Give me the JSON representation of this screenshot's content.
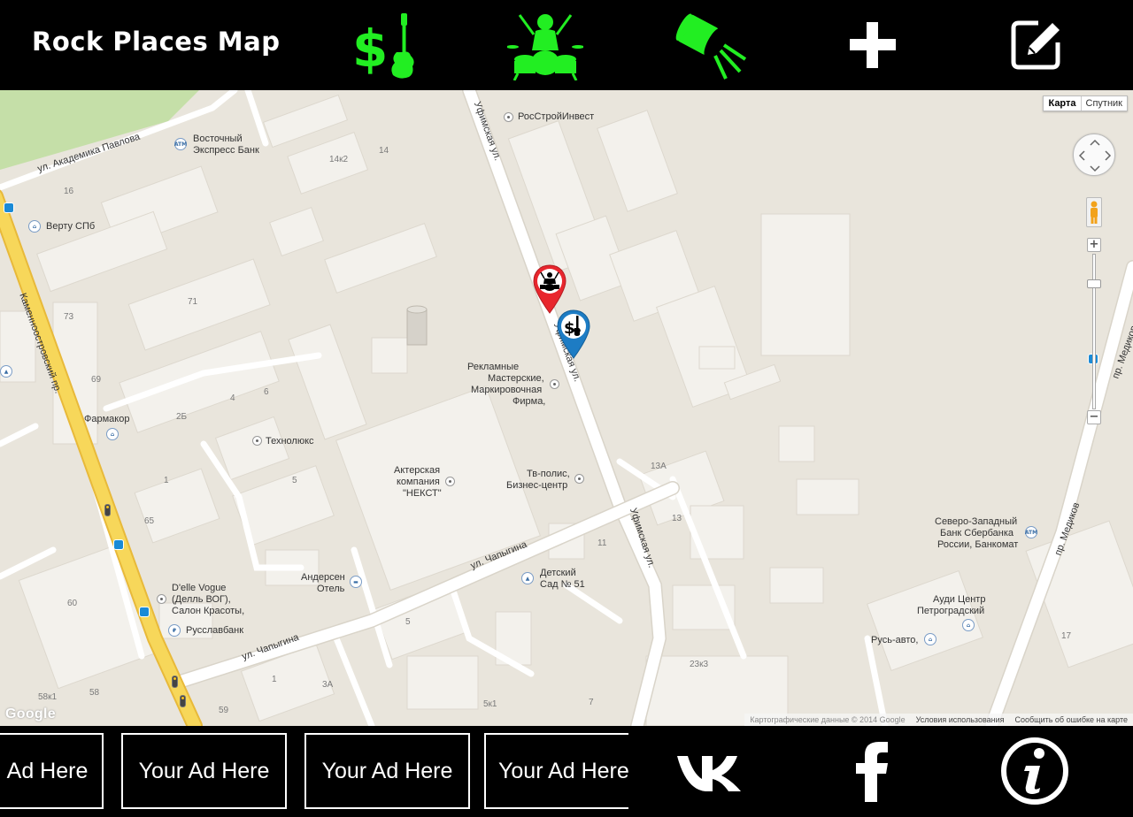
{
  "header": {
    "title": "Rock Places Map",
    "buttons": [
      {
        "name": "shop-icon",
        "icon": "dollar-guitar"
      },
      {
        "name": "drummer-icon",
        "icon": "drummer"
      },
      {
        "name": "spotlight-icon",
        "icon": "spotlight"
      },
      {
        "name": "add-icon",
        "icon": "plus"
      },
      {
        "name": "edit-icon",
        "icon": "edit-square"
      }
    ],
    "accent_color": "#22ee22"
  },
  "map": {
    "type_control": {
      "map": "Карта",
      "satellite": "Спутник",
      "selected": "Карта"
    },
    "zoom_in": "+",
    "zoom_out": "−",
    "provider_logo": "Google",
    "attribution": {
      "data": "Картографические данные © 2014 Google",
      "terms": "Условия использования",
      "report": "Сообщить об ошибке на карте"
    },
    "streets": {
      "akademika_pavlova": "ул. Академика Павлова",
      "ufimskaya_top": "Уфимская ул.",
      "ufimskaya_mid": "Уфимская ул.",
      "ufimskaya_low": "Уфимская ул.",
      "kamennoostrovsky": "Каменноостровский пр.",
      "chapygina_1": "ул. Чапыгина",
      "chapygina_2": "ул. Чапыгина",
      "medikov_1": "пр. Медиков",
      "medikov_2": "пр. Медиков"
    },
    "pois": {
      "rosstroyinvest": "РосСтройИнвест",
      "vostochny_line1": "Восточный",
      "vostochny_line2": "Экспресс Банк",
      "vertu": "Верту СПб",
      "reklamnye_1": "Рекламные",
      "reklamnye_2": "Мастерские,",
      "reklamnye_3": "Маркировочная",
      "reklamnye_4": "Фирма,",
      "farmakor": "Фармакор",
      "tekhnolyuks": "Технолюкс",
      "nekst_1": "Актерская",
      "nekst_2": "компания",
      "nekst_3": "\"НЕКСТ\"",
      "tvpolis_1": "Тв-полис,",
      "tvpolis_2": "Бизнес-центр",
      "anderson_1": "Андерсен",
      "anderson_2": "Отель",
      "detsky_1": "Детский",
      "detsky_2": "Сад № 51",
      "delle_1": "D'elle Vogue",
      "delle_2": "(Делль ВОГ),",
      "delle_3": "Салон Красоты,",
      "russlavbank": "Русславбанк",
      "sber_1": "Северо-Западный",
      "sber_2": "Банк Сбербанка",
      "sber_3": "России, Банкомат",
      "audi_1": "Ауди Центр",
      "audi_2": "Петроградский",
      "rusavto": "Русь-авто,"
    },
    "house_numbers": {
      "h14k2": "14к2",
      "h14": "14",
      "h16": "16",
      "h73": "73",
      "h71": "71",
      "h69": "69",
      "h4": "4",
      "h6": "6",
      "h2b": "2Б",
      "h1": "1",
      "h5": "5",
      "h65": "65",
      "h60": "60",
      "h58": "58",
      "h58k1": "58к1",
      "h59": "59",
      "h13a": "13А",
      "h13": "13",
      "h11": "11",
      "h5b": "5",
      "h3a": "3А",
      "h1b": "1",
      "h5k1": "5к1",
      "h7": "7",
      "h23k3": "23к3",
      "h17": "17"
    },
    "markers": [
      {
        "name": "rehearsal-marker",
        "color": "#e8262d",
        "icon": "drummer"
      },
      {
        "name": "shop-marker",
        "color": "#1d7cc4",
        "icon": "dollar-guitar"
      }
    ]
  },
  "ads": [
    "Ad Here",
    "Your Ad Here",
    "Your Ad Here",
    "Your Ad Here"
  ],
  "social": [
    {
      "name": "vk-icon",
      "label": "VK"
    },
    {
      "name": "facebook-icon",
      "label": "f"
    },
    {
      "name": "info-icon",
      "label": "i"
    }
  ]
}
